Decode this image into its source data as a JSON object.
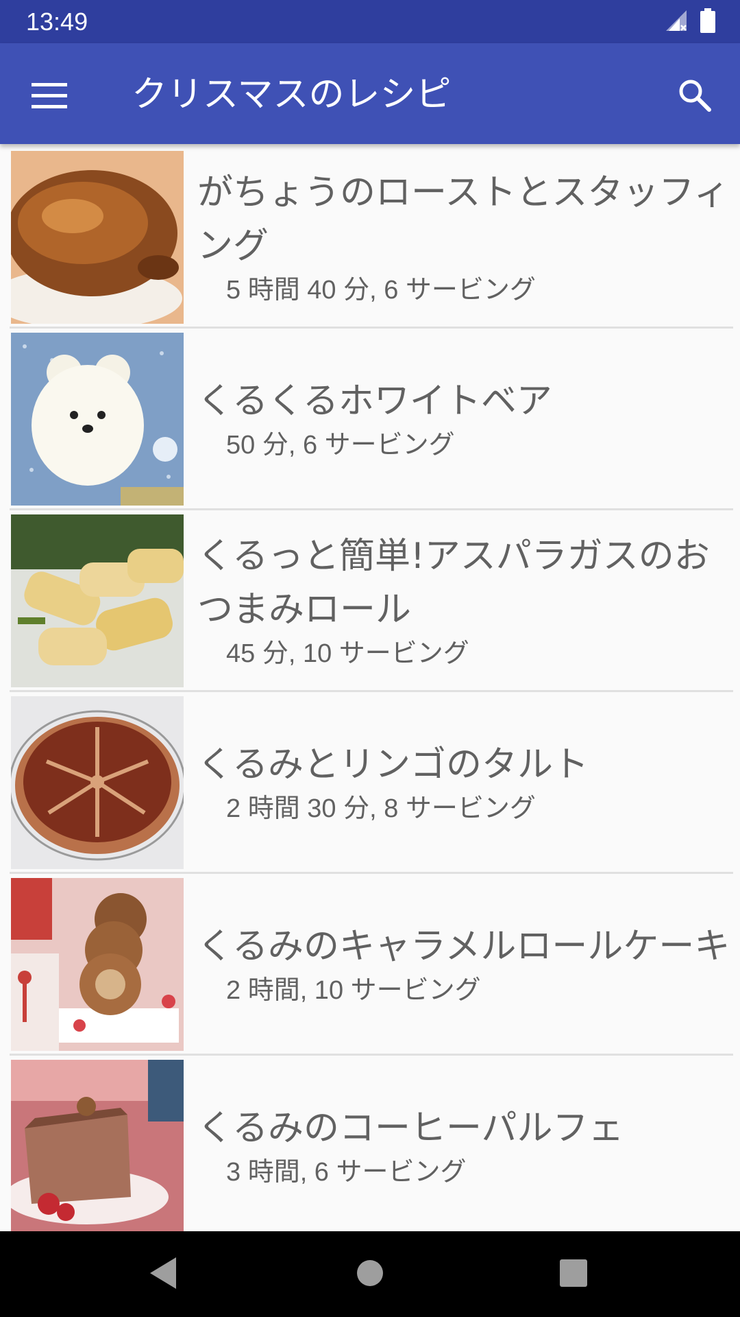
{
  "status_bar": {
    "time": "13:49",
    "icons": [
      "signal-no-data-icon",
      "battery-full-icon"
    ]
  },
  "app_bar": {
    "title": "クリスマスのレシピ",
    "menu_icon": "menu-icon",
    "search_icon": "search-icon",
    "background_color": "#3f51b5",
    "status_color": "#2f3e9e"
  },
  "recipes": [
    {
      "title": "がちょうのローストとスタッフィング",
      "meta": "5 時間 40 分, 6 サービング",
      "image": "roast-goose-photo"
    },
    {
      "title": "くるくるホワイトベア",
      "meta": "50 分, 6 サービング",
      "image": "white-bear-cake-photo"
    },
    {
      "title": "くるっと簡単!アスパラガスのおつまみロール",
      "meta": "45 分, 10 サービング",
      "image": "asparagus-roll-photo"
    },
    {
      "title": "くるみとリンゴのタルト",
      "meta": "2 時間 30 分, 8 サービング",
      "image": "walnut-apple-tart-photo"
    },
    {
      "title": "くるみのキャラメルロールケーキ",
      "meta": "2 時間, 10 サービング",
      "image": "caramel-roll-cake-photo"
    },
    {
      "title": "くるみのコーヒーパルフェ",
      "meta": "3 時間, 6 サービング",
      "image": "coffee-parfait-photo"
    }
  ],
  "nav_bar": {
    "icons": [
      "back-icon",
      "home-icon",
      "recents-icon"
    ]
  }
}
